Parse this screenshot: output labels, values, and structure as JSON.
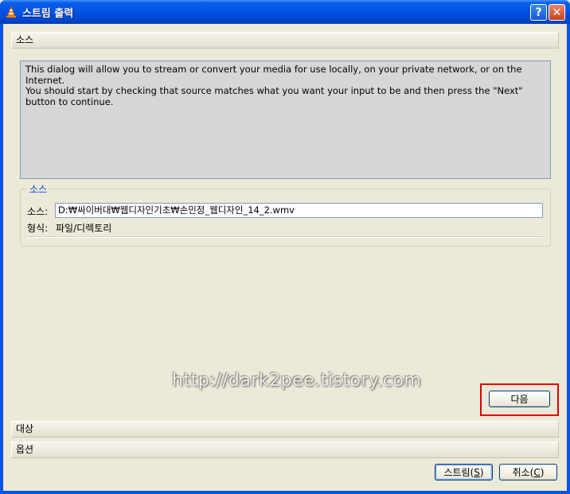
{
  "window": {
    "title": "스트림 출력",
    "help_glyph": "?",
    "close_glyph": "✕"
  },
  "sections": {
    "source": "소스",
    "destination": "대상",
    "options": "옵션"
  },
  "info": {
    "line1": "This dialog will allow you to stream or convert your media for use locally, on your private network, or on the Internet.",
    "line2": "You should start by checking that source matches what you want your input to be and then press the \"Next\" button to continue."
  },
  "source_group": {
    "legend": "소스",
    "source_label": "소스:",
    "source_value": "D:₩싸이버대₩웹디자인기초₩손민정_웹디자인_14_2.wmv",
    "type_label": "형식:",
    "type_value": "파일/디렉토리"
  },
  "watermark": "http://dark2pee.tistory.com",
  "buttons": {
    "next": "다음",
    "stream_prefix": "스트림(",
    "stream_key": "S",
    "stream_suffix": ")",
    "cancel_prefix": "취소(",
    "cancel_key": "C",
    "cancel_suffix": ")"
  },
  "colors": {
    "titlebar": "#0055e5",
    "legend_text": "#0046d5",
    "highlight": "#e40000"
  }
}
